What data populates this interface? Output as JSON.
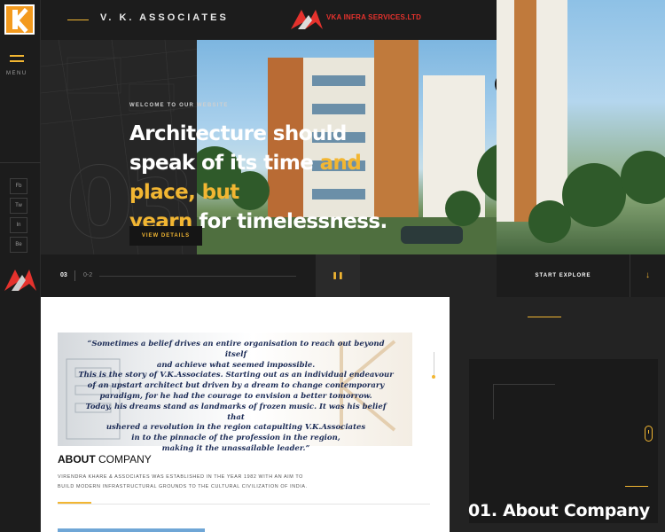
{
  "brand": {
    "company_name": "V. K. ASSOCIATES",
    "partner_logo_text": "VKA INFRA SERVICES.LTD",
    "accent_color": "#f2b632",
    "logo_red": "#e5322d"
  },
  "sidebar": {
    "menu_label": "MENU",
    "social": [
      {
        "label": "Fb",
        "icon": "facebook-icon"
      },
      {
        "label": "Tw",
        "icon": "twitter-icon"
      },
      {
        "label": "In",
        "icon": "linkedin-icon"
      },
      {
        "label": "Be",
        "icon": "behance-icon"
      }
    ]
  },
  "hero": {
    "welcome": "WELCOME TO OUR WEBSITE",
    "headline_part1": "Architecture should speak of its time ",
    "headline_highlight1": "and place, but",
    "headline_highlight2": "yearn",
    "headline_part2": " for timelessness.",
    "cta": "VIEW DETAILS",
    "slide_number_bg": "03",
    "arrow_icon": "arrow-left-right-icon"
  },
  "slider": {
    "current": "03",
    "total": "0-2",
    "pause_icon": "pause-icon",
    "explore_label": "START EXPLORE",
    "down_icon": "arrow-down-icon"
  },
  "about": {
    "quote_line1": "“Sometimes a belief drives an entire organisation to reach out beyond itself",
    "quote_line2": "and achieve what seemed impossible.",
    "quote_line3": "This is the story of V.K.Associates. Starting out as an individual endeavour",
    "quote_line4": "of an upstart architect but driven by a dream to change contemporary",
    "quote_line5": "paradigm, for he had the courage to envision a better tomorrow.",
    "quote_line6": "Today, his dreams stand as landmarks of frozen music. It was his belief that",
    "quote_line7": "ushered a revolution in the region catapulting V.K.Associates",
    "quote_line8": "in to the pinnacle of the profession in the region,",
    "quote_line9": "making it the unassailable leader.”",
    "title_bold": "ABOUT",
    "title_rest": " COMPANY",
    "desc_line1": "VIRENDRA KHARE & ASSOCIATES WAS ESTABLISHED IN THE YEAR 1982 WITH AN AIM TO",
    "desc_line2": "BUILD MODERN INFRASTRUCTURAL GROUNDS TO THE CULTURAL CIVILIZATION OF INDIA."
  },
  "section": {
    "title": "01. About Company"
  }
}
